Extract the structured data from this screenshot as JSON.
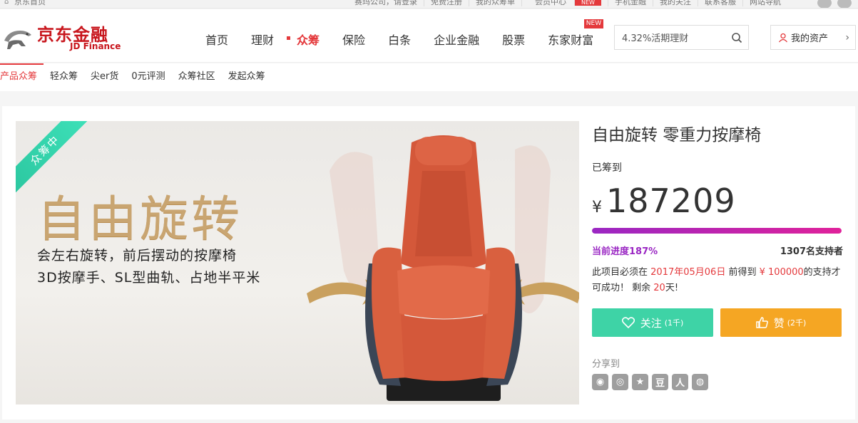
{
  "topbar": {
    "home": "京东首页",
    "links": [
      "赛玛公司，请登录",
      "免费注册",
      "我的众筹单",
      "会员中心",
      "手机金融",
      "我的关注",
      "联系客服",
      "网站导航"
    ],
    "new_badge": "NEW"
  },
  "header": {
    "logo_cn": "京东金融",
    "logo_en": "JD Finance",
    "nav": [
      "首页",
      "理财",
      "众筹",
      "保险",
      "白条",
      "企业金融",
      "股票",
      "东家财富"
    ],
    "nav_new_tag": "NEW",
    "search_value": "4.32%活期理财",
    "assets_label": "我的资产"
  },
  "subnav": [
    "产品众筹",
    "轻众筹",
    "尖er货",
    "0元评测",
    "众筹社区",
    "发起众筹"
  ],
  "banner": {
    "ribbon": "众筹中",
    "headline": "自由旋转",
    "line1": "会左右旋转，前后摆动的按摩椅",
    "line2": "3D按摩手、SL型曲轨、占地半平米"
  },
  "project": {
    "title": "自由旋转 零重力按摩椅",
    "raised_label": "已筹到",
    "currency": "¥",
    "amount": "187209",
    "progress_label": "当前进度187%",
    "progress_fraction": 1.0,
    "supporters": "1307名支持者",
    "desc_a": "此项目必须在",
    "desc_date": "2017年05月06日",
    "desc_b": "前得到",
    "desc_goal": "¥ 100000",
    "desc_c": "的支持才可成功！ 剩余",
    "desc_days": "20",
    "desc_d": "天!",
    "follow_label": "关注",
    "follow_count": "(1千)",
    "like_label": "赞",
    "like_count": "(2千)",
    "share_label": "分享到"
  },
  "colors": {
    "brand_red": "#c8161d",
    "follow_green": "#3ed3a6",
    "like_orange": "#f5a623",
    "progress_start": "#9a27c3",
    "progress_end": "#e0219a"
  }
}
